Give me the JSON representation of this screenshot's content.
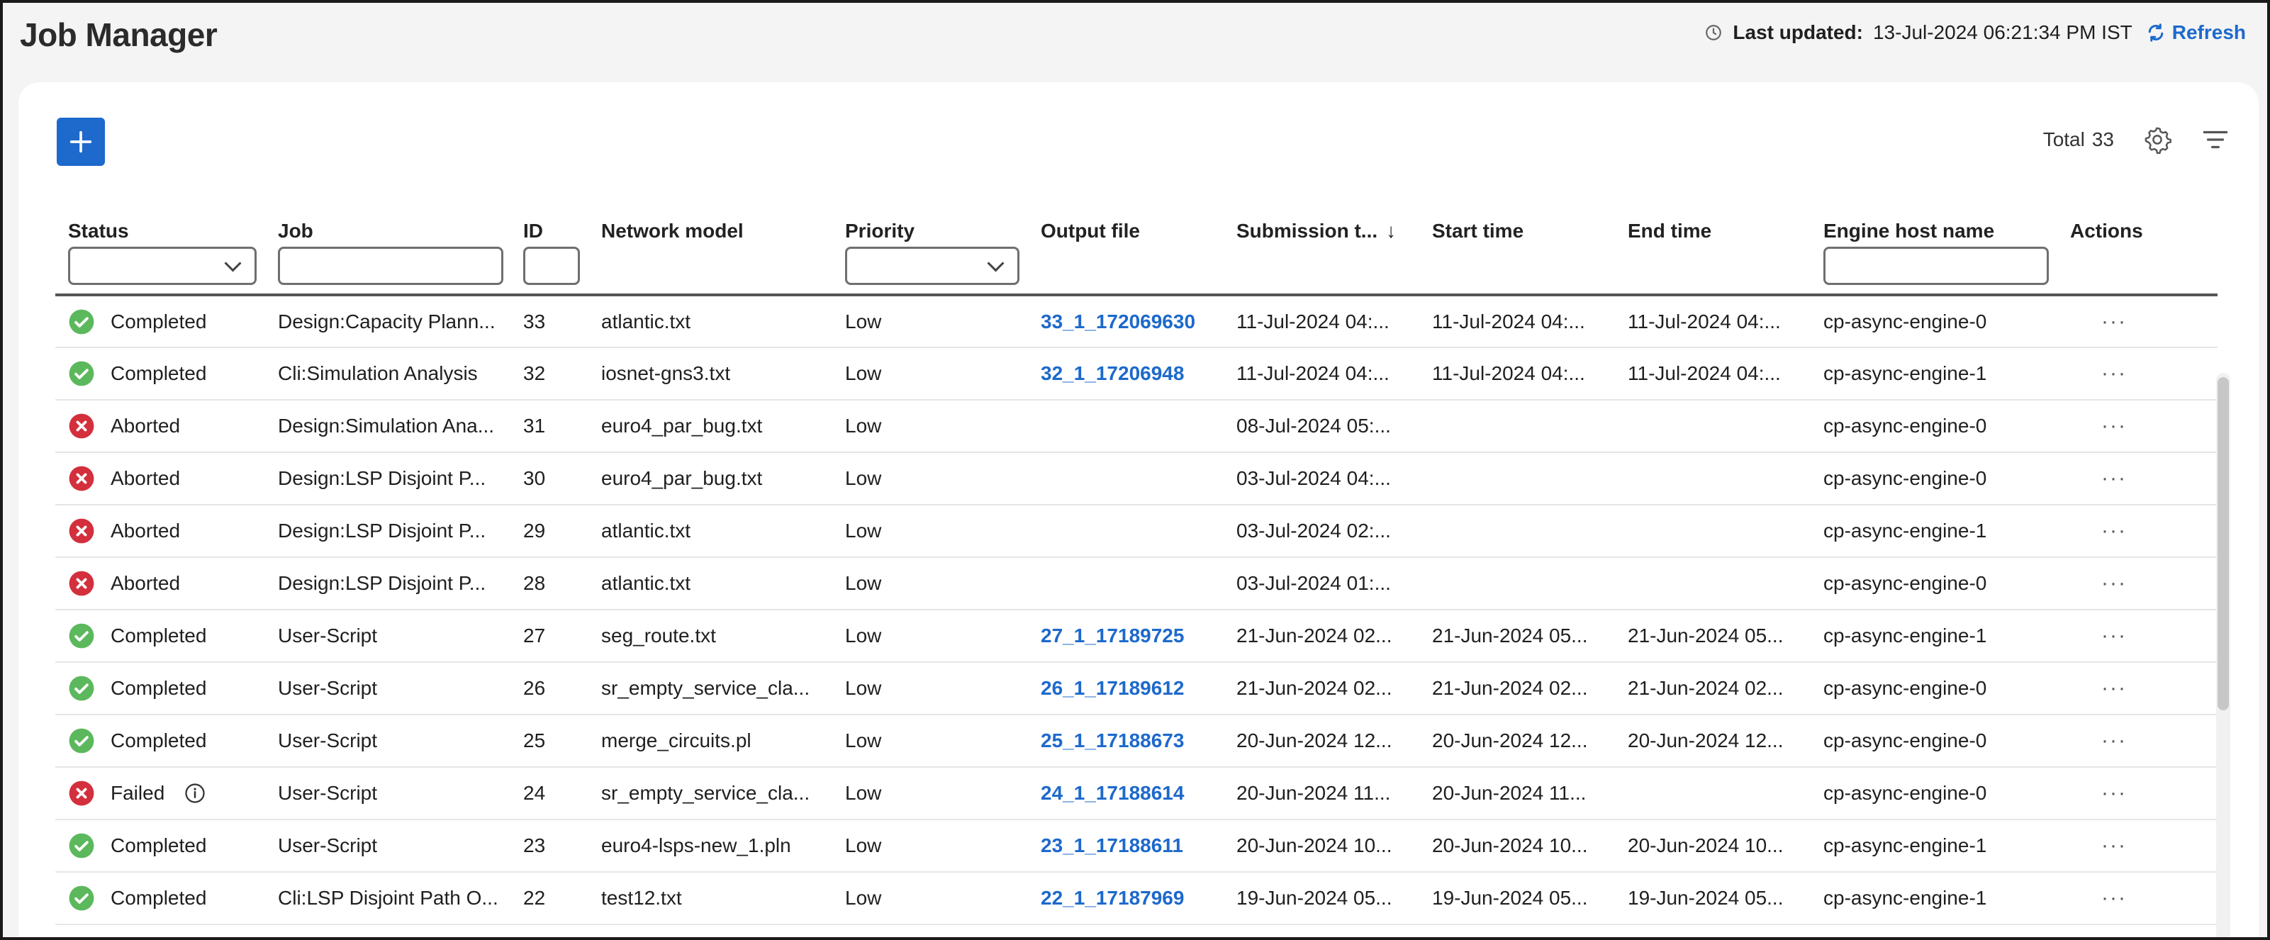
{
  "header": {
    "title": "Job Manager",
    "last_updated_label": "Last updated:",
    "last_updated_value": "13-Jul-2024 06:21:34 PM IST",
    "refresh_label": "Refresh",
    "icons": {
      "clock": "clock-icon",
      "refresh": "refresh-icon"
    }
  },
  "toolbar": {
    "add_icon": "plus-icon",
    "total_label": "Total",
    "total_count": "33",
    "settings_icon": "gear-icon",
    "filter_icon": "filter-icon"
  },
  "columns": {
    "status": "Status",
    "job": "Job",
    "id": "ID",
    "network_model": "Network model",
    "priority": "Priority",
    "output_file": "Output file",
    "submission_time": "Submission t...",
    "start_time": "Start time",
    "end_time": "End time",
    "engine_host": "Engine host name",
    "actions": "Actions"
  },
  "colors": {
    "accent": "#1d69cc",
    "completed": "#5cb85c",
    "aborted": "#d32f3c"
  },
  "rows": [
    {
      "status": "Completed",
      "status_type": "completed",
      "job": "Design:Capacity Plann...",
      "id": "33",
      "network_model": "atlantic.txt",
      "priority": "Low",
      "output_file": "33_1_172069630",
      "submission": "11-Jul-2024 04:...",
      "start": "11-Jul-2024 04:...",
      "end": "11-Jul-2024 04:...",
      "host": "cp-async-engine-0",
      "actions": "···"
    },
    {
      "status": "Completed",
      "status_type": "completed",
      "job": "Cli:Simulation Analysis",
      "id": "32",
      "network_model": "iosnet-gns3.txt",
      "priority": "Low",
      "output_file": "32_1_17206948",
      "submission": "11-Jul-2024 04:...",
      "start": "11-Jul-2024 04:...",
      "end": "11-Jul-2024 04:...",
      "host": "cp-async-engine-1",
      "actions": "···"
    },
    {
      "status": "Aborted",
      "status_type": "aborted",
      "job": "Design:Simulation Ana...",
      "id": "31",
      "network_model": "euro4_par_bug.txt",
      "priority": "Low",
      "output_file": "",
      "submission": "08-Jul-2024 05:...",
      "start": "",
      "end": "",
      "host": "cp-async-engine-0",
      "actions": "···"
    },
    {
      "status": "Aborted",
      "status_type": "aborted",
      "job": "Design:LSP Disjoint P...",
      "id": "30",
      "network_model": "euro4_par_bug.txt",
      "priority": "Low",
      "output_file": "",
      "submission": "03-Jul-2024 04:...",
      "start": "",
      "end": "",
      "host": "cp-async-engine-0",
      "actions": "···"
    },
    {
      "status": "Aborted",
      "status_type": "aborted",
      "job": "Design:LSP Disjoint P...",
      "id": "29",
      "network_model": "atlantic.txt",
      "priority": "Low",
      "output_file": "",
      "submission": "03-Jul-2024 02:...",
      "start": "",
      "end": "",
      "host": "cp-async-engine-1",
      "actions": "···"
    },
    {
      "status": "Aborted",
      "status_type": "aborted",
      "job": "Design:LSP Disjoint P...",
      "id": "28",
      "network_model": "atlantic.txt",
      "priority": "Low",
      "output_file": "",
      "submission": "03-Jul-2024 01:...",
      "start": "",
      "end": "",
      "host": "cp-async-engine-0",
      "actions": "···"
    },
    {
      "status": "Completed",
      "status_type": "completed",
      "job": "User-Script",
      "id": "27",
      "network_model": "seg_route.txt",
      "priority": "Low",
      "output_file": "27_1_17189725",
      "submission": "21-Jun-2024 02...",
      "start": "21-Jun-2024 05...",
      "end": "21-Jun-2024 05...",
      "host": "cp-async-engine-1",
      "actions": "···"
    },
    {
      "status": "Completed",
      "status_type": "completed",
      "job": "User-Script",
      "id": "26",
      "network_model": "sr_empty_service_cla...",
      "priority": "Low",
      "output_file": "26_1_17189612",
      "submission": "21-Jun-2024 02...",
      "start": "21-Jun-2024 02...",
      "end": "21-Jun-2024 02...",
      "host": "cp-async-engine-0",
      "actions": "···"
    },
    {
      "status": "Completed",
      "status_type": "completed",
      "job": "User-Script",
      "id": "25",
      "network_model": "merge_circuits.pl",
      "priority": "Low",
      "output_file": "25_1_17188673",
      "submission": "20-Jun-2024 12...",
      "start": "20-Jun-2024 12...",
      "end": "20-Jun-2024 12...",
      "host": "cp-async-engine-0",
      "actions": "···"
    },
    {
      "status": "Failed",
      "status_type": "failed",
      "job": "User-Script",
      "id": "24",
      "network_model": "sr_empty_service_cla...",
      "priority": "Low",
      "output_file": "24_1_17188614",
      "submission": "20-Jun-2024 11...",
      "start": "20-Jun-2024 11...",
      "end": "",
      "host": "cp-async-engine-0",
      "actions": "···"
    },
    {
      "status": "Completed",
      "status_type": "completed",
      "job": "User-Script",
      "id": "23",
      "network_model": "euro4-lsps-new_1.pln",
      "priority": "Low",
      "output_file": "23_1_17188611",
      "submission": "20-Jun-2024 10...",
      "start": "20-Jun-2024 10...",
      "end": "20-Jun-2024 10...",
      "host": "cp-async-engine-1",
      "actions": "···"
    },
    {
      "status": "Completed",
      "status_type": "completed",
      "job": "Cli:LSP Disjoint Path O...",
      "id": "22",
      "network_model": "test12.txt",
      "priority": "Low",
      "output_file": "22_1_17187969",
      "submission": "19-Jun-2024 05...",
      "start": "19-Jun-2024 05...",
      "end": "19-Jun-2024 05...",
      "host": "cp-async-engine-1",
      "actions": "···"
    }
  ]
}
